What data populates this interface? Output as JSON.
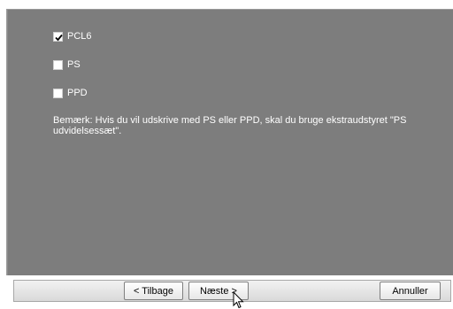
{
  "options": [
    {
      "label": "PCL6",
      "checked": true
    },
    {
      "label": "PS",
      "checked": false
    },
    {
      "label": "PPD",
      "checked": false
    }
  ],
  "note": "Bemærk: Hvis du vil udskrive med PS eller PPD, skal du bruge ekstraudstyret \"PS udvidelsessæt\".",
  "buttons": {
    "back": "< Tilbage",
    "next": "Næste >",
    "cancel": "Annuller"
  },
  "icons": {
    "checkbox_checked": "check-icon",
    "cursor": "mouse-pointer-icon"
  }
}
